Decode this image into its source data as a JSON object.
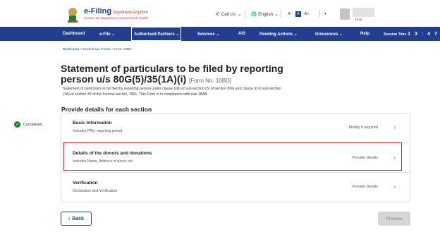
{
  "header": {
    "logo_title": "e-Filing",
    "logo_tagline": "Anywhere Anytime",
    "logo_subtitle": "Income Tax Department, Government of India",
    "call_us": "Call Us",
    "language": "English",
    "font_small": "A-",
    "font_normal": "A",
    "font_large": "A+",
    "user_label": "Trust"
  },
  "nav": {
    "items": [
      "Dashboard",
      "e-File",
      "Authorised Partners",
      "Services",
      "AIS",
      "Pending Actions",
      "Grievances",
      "Help"
    ],
    "session_label": "Session Time",
    "session_value": "1 3 : 4 7"
  },
  "breadcrumb": {
    "items": [
      "Dashboard",
      "Income-tax Forms",
      "Form 10BD"
    ],
    "separator": ">"
  },
  "page": {
    "title": "Statement of particulars to be filed by reporting person u/s 80G(5)/35(1A)(i)",
    "form_no": "[Form No. 10BD]",
    "description": "Statement of particulars to be filed by reporting person under clause (viii) of sub-section (5) of section 80G and clause (i) to sub-section (1A) of section 35 of the Income-tax Act, 1961. This Form is in compliance with rule 18AB.",
    "section_heading": "Provide details for each section"
  },
  "status": {
    "completed_label": "Completed",
    "color": "#1e7e34"
  },
  "sections": [
    {
      "title": "Basic Information",
      "subtitle": "Includes PAN, reporting period",
      "action": "Modify if required"
    },
    {
      "title": "Details of the donors and donations",
      "subtitle": "Includes Name, Address of donor etc.",
      "action": "Provide Details"
    },
    {
      "title": "Verification",
      "subtitle": "Declaration and Verification",
      "action": "Provide Details"
    }
  ],
  "buttons": {
    "back": "Back",
    "preview": "Preview"
  },
  "colors": {
    "nav_bg": "#233d8f",
    "highlight": "#c0242a"
  }
}
